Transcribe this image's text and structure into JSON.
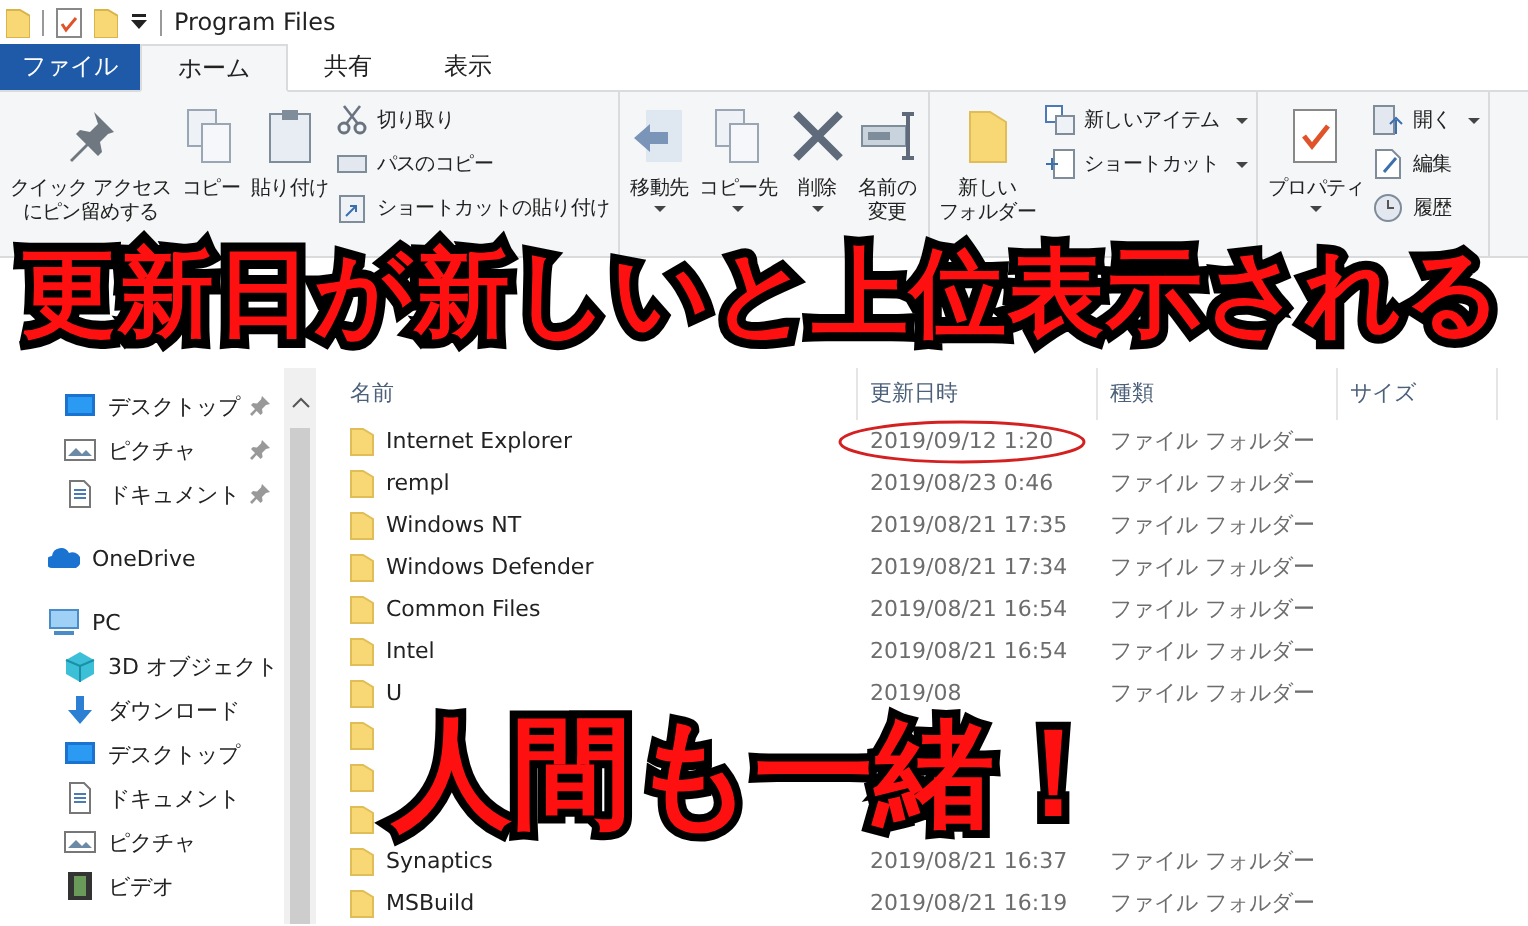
{
  "window": {
    "title": "Program Files"
  },
  "tabs": [
    {
      "label": "ファイル",
      "kind": "file",
      "selected": false
    },
    {
      "label": "ホーム",
      "kind": "tab",
      "selected": true
    },
    {
      "label": "共有",
      "kind": "tab",
      "selected": false
    },
    {
      "label": "表示",
      "kind": "tab",
      "selected": false
    }
  ],
  "ribbon": {
    "groups": [
      {
        "large": [
          {
            "lines": [
              "クイック アクセス",
              "にピン留めする"
            ],
            "dropdown": false
          },
          {
            "lines": [
              "コピー"
            ],
            "dropdown": false
          },
          {
            "lines": [
              "貼り付け"
            ],
            "dropdown": false
          }
        ],
        "small": [
          {
            "label": "切り取り",
            "dropdown": false
          },
          {
            "label": "パスのコピー",
            "dropdown": false
          },
          {
            "label": "ショートカットの貼り付け",
            "dropdown": false
          }
        ]
      },
      {
        "large": [
          {
            "lines": [
              "移動先"
            ],
            "dropdown": true
          },
          {
            "lines": [
              "コピー先"
            ],
            "dropdown": true
          },
          {
            "lines": [
              "削除"
            ],
            "dropdown": true
          },
          {
            "lines": [
              "名前の",
              "変更"
            ],
            "dropdown": false
          }
        ]
      },
      {
        "large": [
          {
            "lines": [
              "新しい",
              "フォルダー"
            ],
            "dropdown": false
          }
        ],
        "small": [
          {
            "label": "新しいアイテム",
            "dropdown": true
          },
          {
            "label": "ショートカット",
            "dropdown": true
          }
        ]
      },
      {
        "large": [
          {
            "lines": [
              "プロパティ"
            ],
            "dropdown": true
          }
        ],
        "small": [
          {
            "label": "開く",
            "dropdown": true
          },
          {
            "label": "編集",
            "dropdown": false
          },
          {
            "label": "履歴",
            "dropdown": false
          }
        ]
      }
    ]
  },
  "sidebar": {
    "items": [
      {
        "label": "デスクトップ",
        "kind": "desktop",
        "pinned": true
      },
      {
        "label": "ピクチャ",
        "kind": "pictures",
        "pinned": true
      },
      {
        "label": "ドキュメント",
        "kind": "documents",
        "pinned": true
      },
      {
        "label": "OneDrive",
        "kind": "cloud",
        "pinned": false
      },
      {
        "label": "PC",
        "kind": "pc",
        "pinned": false,
        "children": [
          {
            "label": "3D オブジェクト",
            "kind": "objects",
            "pinned": false
          },
          {
            "label": "ダウンロード",
            "kind": "download",
            "pinned": false
          },
          {
            "label": "デスクトップ",
            "kind": "desktop",
            "pinned": false
          },
          {
            "label": "ドキュメント",
            "kind": "documents",
            "pinned": false
          },
          {
            "label": "ピクチャ",
            "kind": "pictures",
            "pinned": false
          },
          {
            "label": "ビデオ",
            "kind": "video",
            "pinned": false
          }
        ]
      }
    ]
  },
  "table": {
    "columns": [
      "名前",
      "更新日時",
      "種類",
      "サイズ"
    ],
    "rows": [
      {
        "name": "Internet Explorer",
        "date": "2019/09/12 1:20",
        "type": "ファイル フォルダー",
        "circled": true
      },
      {
        "name": "rempl",
        "date": "2019/08/23 0:46",
        "type": "ファイル フォルダー",
        "circled": false
      },
      {
        "name": "Windows NT",
        "date": "2019/08/21 17:35",
        "type": "ファイル フォルダー",
        "circled": false
      },
      {
        "name": "Windows Defender",
        "date": "2019/08/21 17:34",
        "type": "ファイル フォルダー",
        "circled": false
      },
      {
        "name": "Common Files",
        "date": "2019/08/21 16:54",
        "type": "ファイル フォルダー",
        "circled": false
      },
      {
        "name": "Intel",
        "date": "2019/08/21 16:54",
        "type": "ファイル フォルダー",
        "circled": false
      },
      {
        "name": "U",
        "date": "2019/08",
        "type": "ファイル フォルダー",
        "circled": false
      },
      {},
      {},
      {},
      {
        "name": "Synaptics",
        "date": "2019/08/21 16:37",
        "type": "ファイル フォルダー",
        "circled": false
      },
      {
        "name": "MSBuild",
        "date": "2019/08/21 16:19",
        "type": "ファイル フォルダー",
        "circled": false
      }
    ]
  },
  "overlay": {
    "headline": "更新日が新しいと上位表示される",
    "punchline": "人間も一緒！"
  }
}
